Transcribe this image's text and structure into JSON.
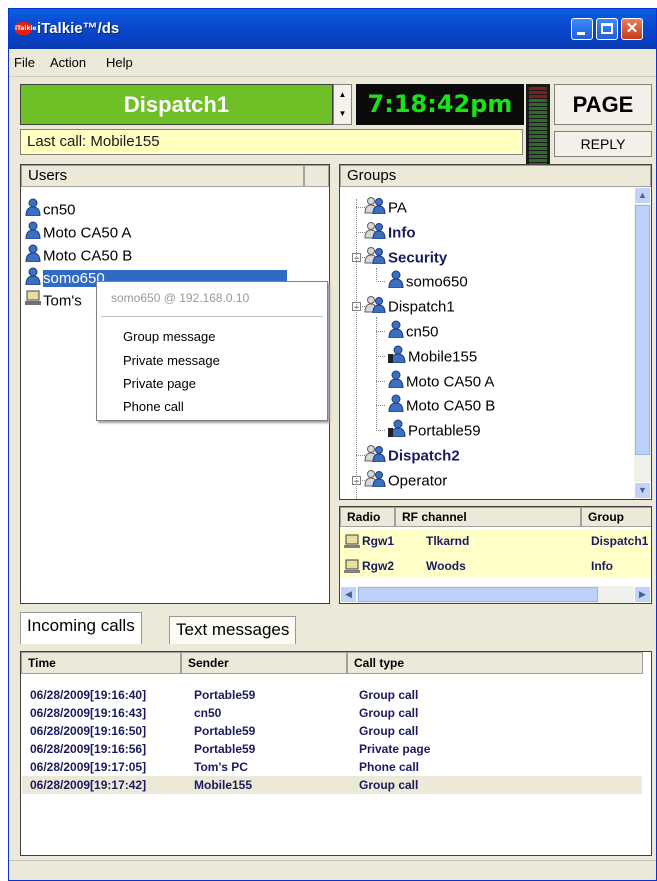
{
  "window": {
    "title": "iTalkie™/ds",
    "logo_text": "iTalkie"
  },
  "menu": [
    "File",
    "Action",
    "Help"
  ],
  "dispatch": {
    "channel": "Dispatch1",
    "clock": "7:18:42pm",
    "page_label": "PAGE",
    "reply_label": "REPLY",
    "last_call": "Last call: Mobile155"
  },
  "users": {
    "header": "Users",
    "items": [
      {
        "name": "cn50",
        "icon": "person-icon"
      },
      {
        "name": "Moto CA50 A",
        "icon": "person-icon"
      },
      {
        "name": "Moto CA50 B",
        "icon": "person-icon"
      },
      {
        "name": "somo650",
        "icon": "person-icon",
        "selected": true
      },
      {
        "name": "Tom's",
        "icon": "computer-icon"
      }
    ]
  },
  "context_menu": {
    "header": "somo650 @ 192.168.0.10",
    "items": [
      "Group message",
      "Private message",
      "Private page",
      "Phone call"
    ]
  },
  "groups": {
    "header": "Groups",
    "tree": [
      {
        "label": "PA",
        "level": 0,
        "icon": "group-icon"
      },
      {
        "label": "Info",
        "level": 0,
        "icon": "group-icon",
        "bold": true
      },
      {
        "label": "Security",
        "level": 0,
        "icon": "group-icon",
        "bold": true,
        "expanded": true
      },
      {
        "label": "somo650",
        "level": 1,
        "icon": "person-icon"
      },
      {
        "label": "Dispatch1",
        "level": 0,
        "icon": "group-icon",
        "expanded": true
      },
      {
        "label": "cn50",
        "level": 1,
        "icon": "person-icon"
      },
      {
        "label": "Mobile155",
        "level": 1,
        "icon": "radio-user-icon"
      },
      {
        "label": "Moto CA50 A",
        "level": 1,
        "icon": "person-icon"
      },
      {
        "label": "Moto CA50 B",
        "level": 1,
        "icon": "person-icon"
      },
      {
        "label": "Portable59",
        "level": 1,
        "icon": "radio-user-icon"
      },
      {
        "label": "Dispatch2",
        "level": 0,
        "icon": "group-icon",
        "bold": true
      },
      {
        "label": "Operator",
        "level": 0,
        "icon": "group-icon",
        "expanded": true
      }
    ]
  },
  "radios": {
    "columns": [
      "Radio",
      "RF channel",
      "Group"
    ],
    "rows": [
      {
        "radio": "Rgw1",
        "channel": "Tlkarnd",
        "group": "Dispatch1"
      },
      {
        "radio": "Rgw2",
        "channel": "Woods",
        "group": "Info"
      }
    ]
  },
  "tabs": [
    "Incoming calls",
    "Text messages"
  ],
  "calls": {
    "columns": [
      "Time",
      "Sender",
      "Call type"
    ],
    "rows": [
      {
        "time": "06/28/2009[19:16:40]",
        "sender": "Portable59",
        "type": "Group call"
      },
      {
        "time": "06/28/2009[19:16:43]",
        "sender": "cn50",
        "type": "Group call"
      },
      {
        "time": "06/28/2009[19:16:50]",
        "sender": "Portable59",
        "type": "Group call"
      },
      {
        "time": "06/28/2009[19:16:56]",
        "sender": "Portable59",
        "type": "Private page"
      },
      {
        "time": "06/28/2009[19:17:05]",
        "sender": "Tom's PC",
        "type": "Phone call"
      },
      {
        "time": "06/28/2009[19:17:42]",
        "sender": "Mobile155",
        "type": "Group call",
        "selected": true
      }
    ]
  },
  "colors": {
    "titlebar": "#0a49d0",
    "dispatch_bg": "#6ec026",
    "clock_fg": "#19e219",
    "last_call_bg": "#ffffc0",
    "selection": "#316ac5"
  }
}
